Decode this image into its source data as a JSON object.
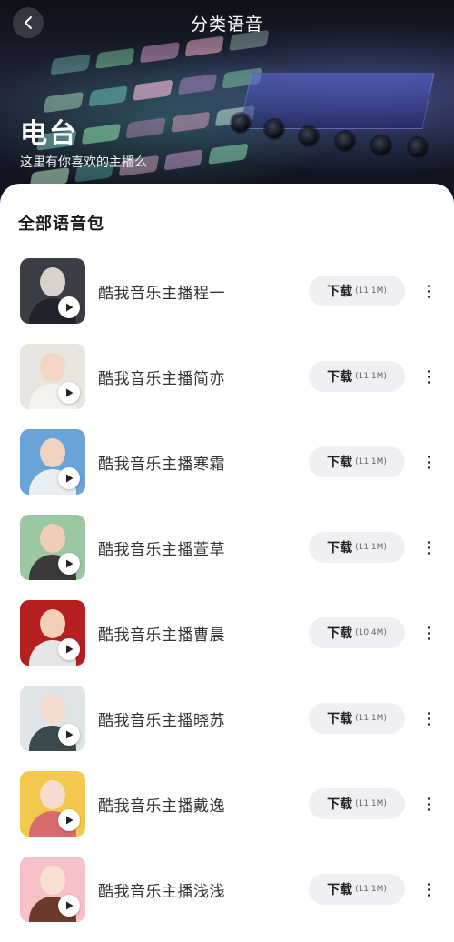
{
  "header": {
    "title": "分类语音",
    "back_icon": "chevron-left-icon"
  },
  "hero": {
    "title": "电台",
    "subtitle": "这里有你喜欢的主播么"
  },
  "section": {
    "title": "全部语音包"
  },
  "colors": {
    "accent_bg": "#eef0f4",
    "text_primary": "#333333"
  },
  "items": [
    {
      "name": "酷我音乐主播程一",
      "download_label": "下载",
      "size": "(11.1M)",
      "avatar_bg": "#3a3d44",
      "avatar_skin": "#d9d2cc",
      "avatar_cloth": "#20232a"
    },
    {
      "name": "酷我音乐主播简亦",
      "download_label": "下载",
      "size": "(11.1M)",
      "avatar_bg": "#e9e5e0",
      "avatar_skin": "#f1d6c6",
      "avatar_cloth": "#f5f3f0"
    },
    {
      "name": "酷我音乐主播寒霜",
      "download_label": "下载",
      "size": "(11.1M)",
      "avatar_bg": "#6aa3d8",
      "avatar_skin": "#f0d2c0",
      "avatar_cloth": "#e9eef2"
    },
    {
      "name": "酷我音乐主播萱草",
      "download_label": "下载",
      "size": "(11.1M)",
      "avatar_bg": "#9cc7a3",
      "avatar_skin": "#efcdb7",
      "avatar_cloth": "#3c3a38"
    },
    {
      "name": "酷我音乐主播曹晨",
      "download_label": "下载",
      "size": "(10.4M)",
      "avatar_bg": "#b51f1f",
      "avatar_skin": "#f2d0b8",
      "avatar_cloth": "#e6e6e6"
    },
    {
      "name": "酷我音乐主播晓苏",
      "download_label": "下载",
      "size": "(11.1M)",
      "avatar_bg": "#dfe4e6",
      "avatar_skin": "#f4dcd0",
      "avatar_cloth": "#3b4a4e"
    },
    {
      "name": "酷我音乐主播戴逸",
      "download_label": "下载",
      "size": "(11.1M)",
      "avatar_bg": "#f2c94c",
      "avatar_skin": "#f6dccf",
      "avatar_cloth": "#d86b6b"
    },
    {
      "name": "酷我音乐主播浅浅",
      "download_label": "下载",
      "size": "(11.1M)",
      "avatar_bg": "#f7c1c8",
      "avatar_skin": "#f8e0d2",
      "avatar_cloth": "#6b3a2c"
    }
  ]
}
